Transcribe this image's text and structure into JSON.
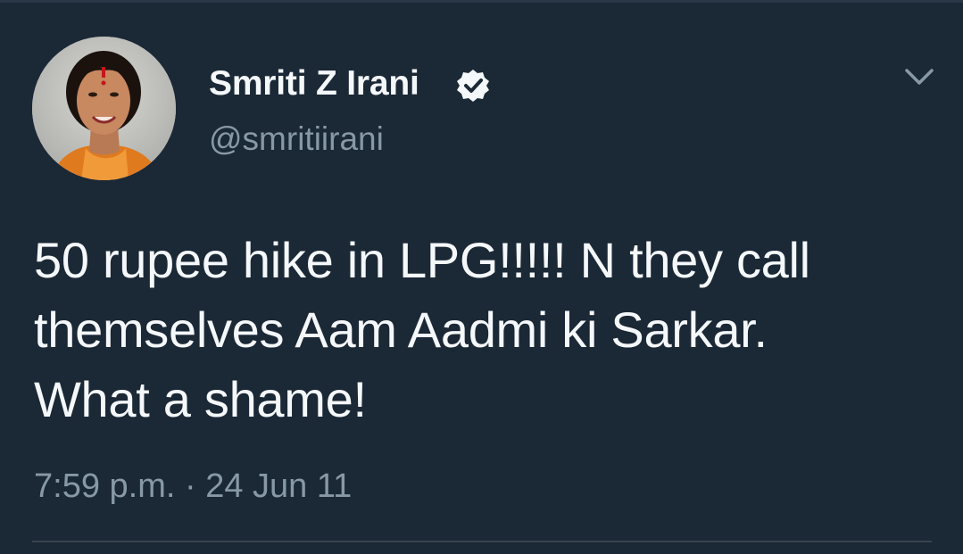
{
  "tweet": {
    "author": {
      "display_name": "Smriti Z Irani",
      "handle": "@smritiirani",
      "verified": true,
      "verified_icon": "verified-badge-icon"
    },
    "text_lines": [
      "50 rupee hike in LPG!!!!! N they call",
      "themselves Aam Aadmi ki Sarkar.",
      "What a shame!"
    ],
    "timestamp": "7:59 p.m. · 24 Jun 11"
  },
  "icons": {
    "menu": "chevron-down-icon"
  },
  "colors": {
    "background": "#1b2836",
    "primary_text": "#f5f8fa",
    "secondary_text": "#8899a6",
    "divider": "#38444d"
  }
}
